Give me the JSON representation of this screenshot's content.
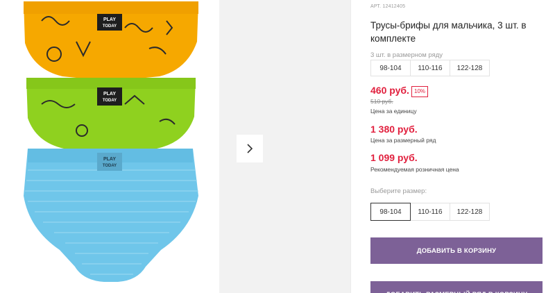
{
  "product": {
    "article_label": "АРТ. 12412405",
    "title": "Трусы-брифы для мальчика, 3 шт. в комплекте",
    "set_label": "3 шт. в размерном ряду",
    "set_sizes": [
      "98-104",
      "110-116",
      "122-128"
    ],
    "price_unit": "460 руб.",
    "discount_badge": "10%",
    "old_price": "510 руб.",
    "price_unit_note": "Цена за единицу",
    "price_set": "1 380 руб.",
    "price_set_note": "Цена за размерный ряд",
    "price_rrp": "1 099 руб.",
    "price_rrp_note": "Рекомендуемая розничная цена",
    "choose_size_label": "Выберите размер:",
    "size_options": [
      "98-104",
      "110-116",
      "122-128"
    ],
    "selected_size": "98-104",
    "add_to_cart": "ДОБАВИТЬ В КОРЗИНУ",
    "second_button": "ДОБАВИТЬ РАЗМЕРНЫЙ РЯД В КОРЗИНУ"
  },
  "gallery": {
    "brand_tag_line1": "PLAY",
    "brand_tag_line2": "TODAY",
    "next_icon": "chevron-right-icon",
    "colors": {
      "orange": "#f6a800",
      "green": "#8fd11f",
      "blue": "#6fc6ea"
    }
  },
  "colors": {
    "accent": "#7d6197",
    "price": "#e11f3d"
  }
}
